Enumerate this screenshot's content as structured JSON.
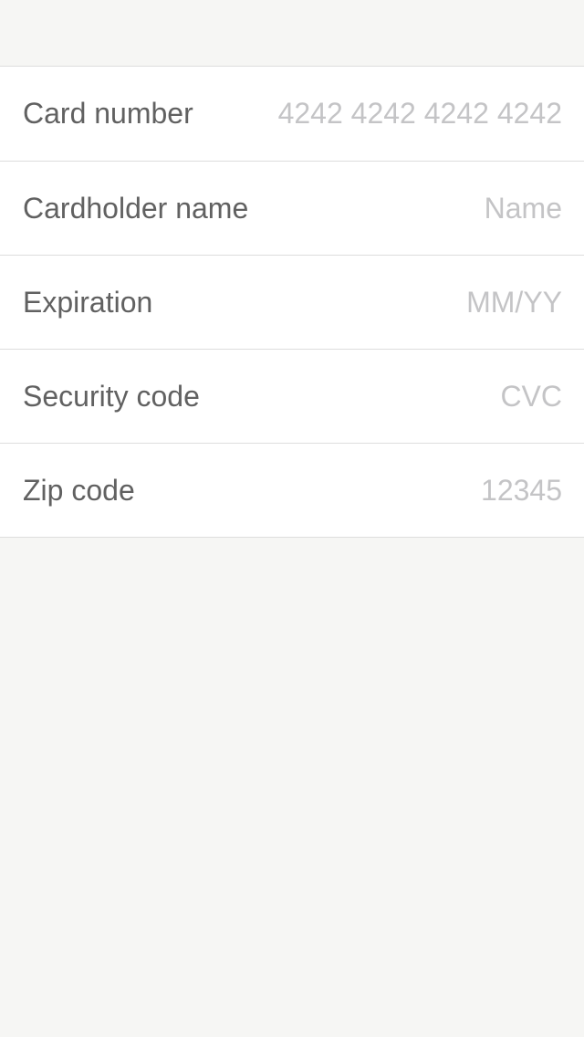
{
  "form": {
    "fields": [
      {
        "label": "Card number",
        "value": "",
        "placeholder": "4242 4242 4242 4242"
      },
      {
        "label": "Cardholder name",
        "value": "",
        "placeholder": "Name"
      },
      {
        "label": "Expiration",
        "value": "",
        "placeholder": "MM/YY"
      },
      {
        "label": "Security code",
        "value": "",
        "placeholder": "CVC"
      },
      {
        "label": "Zip code",
        "value": "",
        "placeholder": "12345"
      }
    ]
  },
  "colors": {
    "background": "#f6f6f4",
    "row_background": "#ffffff",
    "separator": "#dddddd",
    "label_text": "#616161",
    "placeholder_text": "#c4c4c6"
  }
}
